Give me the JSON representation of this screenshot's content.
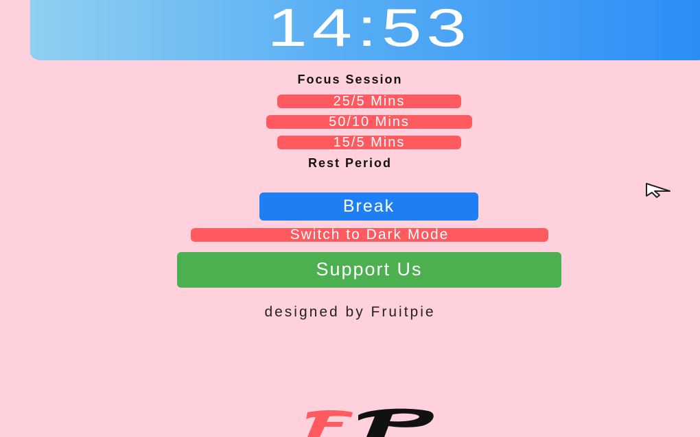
{
  "timer": {
    "display": "14:53"
  },
  "labels": {
    "focus_session": "Focus Session",
    "rest_period": "Rest Period",
    "credit": "designed by Fruitpie"
  },
  "presets": [
    {
      "label": "25/5 Mins"
    },
    {
      "label": "50/10 Mins"
    },
    {
      "label": "15/5 Mins"
    }
  ],
  "buttons": {
    "break_label": "Break",
    "dark_mode_label": "Switch to Dark Mode",
    "support_label": "Support Us"
  },
  "logo": {
    "text": "FP",
    "icon": "fruitpie-logo-icon"
  },
  "colors": {
    "background": "#ffd1dc",
    "timer_gradient_start": "#8fd0f0",
    "timer_gradient_end": "#2b8df5",
    "preset_pill": "#ff5a5f",
    "break_button": "#1e7ff5",
    "support_button": "#4caf50",
    "logo_f": "#ff5a5f",
    "logo_p": "#111111"
  }
}
